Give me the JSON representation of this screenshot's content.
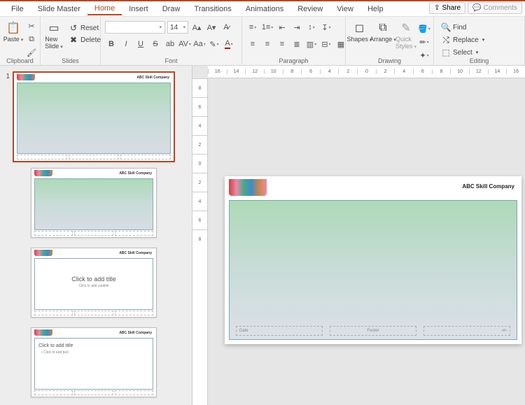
{
  "menu": {
    "tabs": [
      "File",
      "Slide Master",
      "Home",
      "Insert",
      "Draw",
      "Transitions",
      "Animations",
      "Review",
      "View",
      "Help"
    ],
    "active": "Home",
    "share": "Share",
    "comments": "Comments"
  },
  "ribbon": {
    "clipboard": {
      "label": "Clipboard",
      "paste": "Paste"
    },
    "slides": {
      "label": "Slides",
      "newslide": "New\nSlide",
      "reset": "Reset",
      "delete": "Delete"
    },
    "font": {
      "label": "Font",
      "size": "14"
    },
    "paragraph": {
      "label": "Paragraph"
    },
    "drawing": {
      "label": "Drawing",
      "shapes": "Shapes",
      "arrange": "Arrange",
      "quick": "Quick\nStyles"
    },
    "editing": {
      "label": "Editing",
      "find": "Find",
      "replace": "Replace",
      "select": "Select"
    }
  },
  "thumbs": {
    "num1": "1",
    "company": "ABC Skill Company",
    "click_title": "Click to add title",
    "click_sub": "Click to add subtitle",
    "click_text": "Click to add text"
  },
  "slide": {
    "company": "ABC Skill Company",
    "date": "Date",
    "footer": "Footer",
    "pagenum": "‹#›"
  },
  "ruler": {
    "h": [
      "16",
      "14",
      "12",
      "10",
      "8",
      "6",
      "4",
      "2",
      "0",
      "2",
      "4",
      "6",
      "8",
      "10",
      "12",
      "14",
      "16"
    ],
    "v": [
      "8",
      "6",
      "4",
      "2",
      "0",
      "2",
      "4",
      "6",
      "8"
    ]
  }
}
